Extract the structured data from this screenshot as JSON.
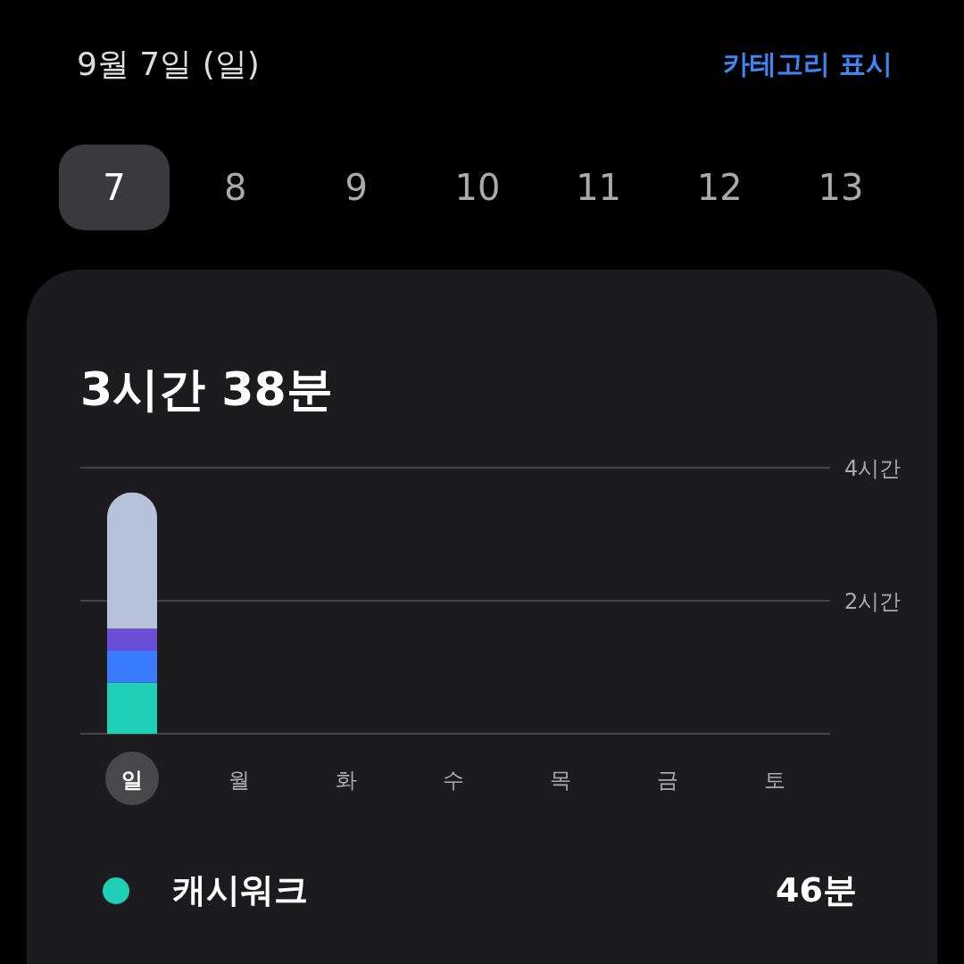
{
  "header": {
    "title": "9월 7일 (일)",
    "action": "카테고리 표시"
  },
  "dates": [
    {
      "label": "7",
      "selected": true
    },
    {
      "label": "8",
      "selected": false
    },
    {
      "label": "9",
      "selected": false
    },
    {
      "label": "10",
      "selected": false
    },
    {
      "label": "11",
      "selected": false
    },
    {
      "label": "12",
      "selected": false
    },
    {
      "label": "13",
      "selected": false
    }
  ],
  "summary": {
    "total": "3시간 38분",
    "chart_data": {
      "type": "bar",
      "stacked": true,
      "categories": [
        "일",
        "월",
        "화",
        "수",
        "목",
        "금",
        "토"
      ],
      "series": [
        {
          "color": "#1fcfb6",
          "values": [
            0.77,
            0,
            0,
            0,
            0,
            0,
            0
          ]
        },
        {
          "color": "#3a7bff",
          "values": [
            0.48,
            0,
            0,
            0,
            0,
            0,
            0
          ]
        },
        {
          "color": "#6a4fd6",
          "values": [
            0.33,
            0,
            0,
            0,
            0,
            0,
            0
          ]
        },
        {
          "color": "#b5c2d9",
          "values": [
            2.05,
            0,
            0,
            0,
            0,
            0,
            0
          ]
        }
      ],
      "ylim": [
        0,
        4
      ],
      "yticks": [
        {
          "value": 2,
          "label": "2시간"
        },
        {
          "value": 4,
          "label": "4시간"
        }
      ]
    },
    "category_selected": [
      true,
      false,
      false,
      false,
      false,
      false,
      false
    ]
  },
  "apps": [
    {
      "name": "캐시워크",
      "time": "46분",
      "color": "#1fcfb6"
    }
  ]
}
